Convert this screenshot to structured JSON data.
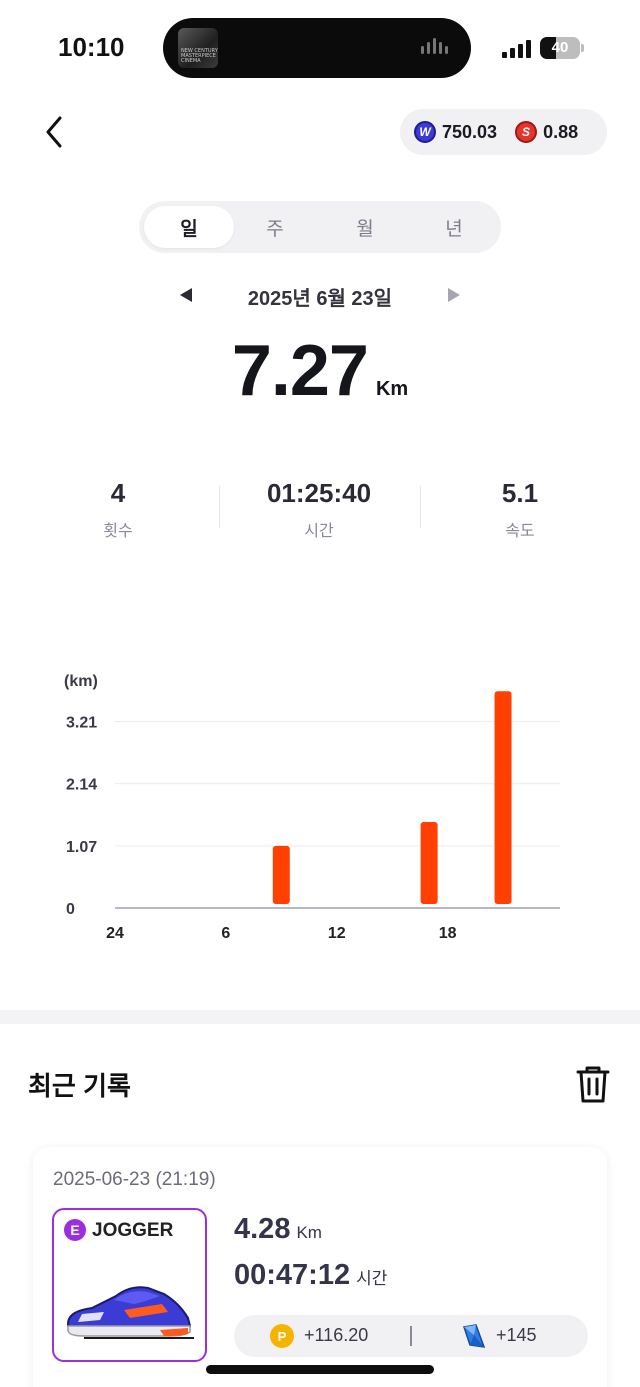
{
  "status_bar": {
    "time": "10:10",
    "battery": "40",
    "battery_level": 0.4,
    "island_art_text": "NEW CENTURY MASTERPIECE CINEMA"
  },
  "header": {
    "back_icon": "chevron-left-icon",
    "balance_w": "750.03",
    "balance_s": "0.88",
    "coin_w_letter": "W",
    "coin_s_letter": "S"
  },
  "period_tabs": [
    {
      "label": "일",
      "active": true
    },
    {
      "label": "주",
      "active": false
    },
    {
      "label": "월",
      "active": false
    },
    {
      "label": "년",
      "active": false
    }
  ],
  "date_nav": {
    "label": "2025년 6월 23일"
  },
  "summary": {
    "distance": "7.27",
    "unit": "Km",
    "stats": [
      {
        "value": "4",
        "label": "횟수"
      },
      {
        "value": "01:25:40",
        "label": "시간"
      },
      {
        "value": "5.1",
        "label": "속도"
      }
    ]
  },
  "chart_data": {
    "type": "bar",
    "ylabel": "(km)",
    "yticks": [
      "0",
      "1.07",
      "2.14",
      "3.21"
    ],
    "ytick_values": [
      0,
      1.07,
      2.14,
      3.21
    ],
    "xticks": [
      "24",
      "6",
      "12",
      "18"
    ],
    "xtick_hours": [
      0,
      6,
      12,
      18
    ],
    "xlim": [
      0,
      23
    ],
    "ylim": [
      0,
      3.89
    ],
    "grid": true,
    "bar_color": "#ff4000",
    "x": [
      9,
      17,
      21
    ],
    "values": [
      1.07,
      1.48,
      3.73
    ]
  },
  "recent": {
    "title": "최근 기록",
    "trash_icon": "trash-icon",
    "record": {
      "date": "2025-06-23 (21:19)",
      "grade": "E",
      "shoe_type": "JOGGER",
      "distance": "4.28",
      "distance_unit": "Km",
      "time": "00:47:12",
      "time_unit": "시간",
      "point_letter": "P",
      "reward_points": "+116.20",
      "reward_gems": "+145"
    }
  },
  "colors": {
    "accent": "#ff4000",
    "grade_purple": "#9b2fe0"
  }
}
